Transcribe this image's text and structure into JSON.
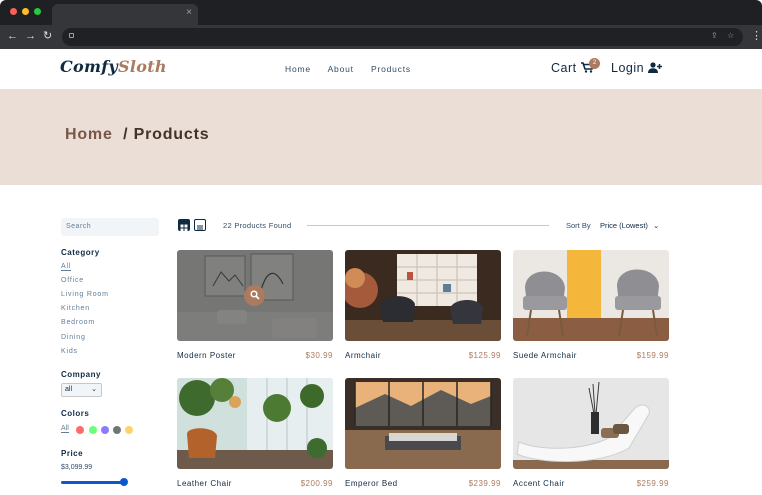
{
  "browser": {
    "tab_close": "×",
    "nav": {
      "back": "←",
      "forward": "→",
      "reload": "↻",
      "menu": "⋮"
    },
    "address_icons": {
      "share": "⇪",
      "star": "☆",
      "panel": "▭"
    }
  },
  "site": {
    "logo": {
      "part1": "Comfy",
      "part2": "Sloth"
    },
    "nav_links": [
      "Home",
      "About",
      "Products"
    ],
    "cart_label": "Cart",
    "cart_icon": "🛒",
    "cart_count": "2",
    "login_label": "Login",
    "login_icon": "👤+"
  },
  "hero": {
    "home": "Home",
    "separator": "/",
    "current": "Products"
  },
  "filters": {
    "search_placeholder": "Search",
    "category_title": "Category",
    "categories": [
      "All",
      "Office",
      "Living Room",
      "Kitchen",
      "Bedroom",
      "Dining",
      "Kids"
    ],
    "company_title": "Company",
    "company_value": "all",
    "colors_title": "Colors",
    "colors_all": "All",
    "colors": [
      "#ff5050",
      "#40ff00",
      "#0000ff",
      "#000000",
      "#ffb900"
    ],
    "price_title": "Price",
    "price_value": "$3,099.99",
    "price_fraction": 1.0
  },
  "toolbar": {
    "products_found": "22 Products Found",
    "sort_label": "Sort By",
    "sort_value": "Price (Lowest)",
    "sort_chevron": "⌄"
  },
  "products": [
    {
      "name": "Modern Poster",
      "price": "$30.99",
      "hover": true
    },
    {
      "name": "Armchair",
      "price": "$125.99"
    },
    {
      "name": "Suede Armchair",
      "price": "$159.99"
    },
    {
      "name": "Leather Chair",
      "price": "$200.99"
    },
    {
      "name": "Emperor Bed",
      "price": "$239.99"
    },
    {
      "name": "Accent Chair",
      "price": "$259.99"
    }
  ],
  "colors": {
    "brand": "#ab7a5f",
    "hero_bg": "#eaded7",
    "text_dark": "#102a42"
  }
}
